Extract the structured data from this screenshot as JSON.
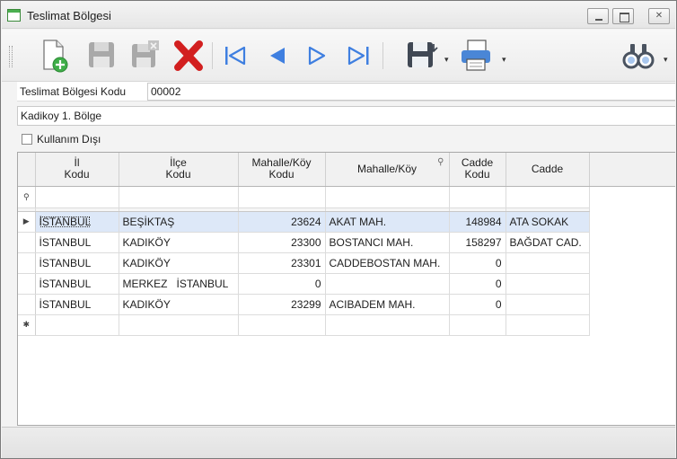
{
  "window": {
    "title": "Teslimat Bölgesi"
  },
  "toolbar": {
    "items": [
      "new-icon",
      "save-icon",
      "save-disabled-icon",
      "delete-icon",
      "first-record-icon",
      "previous-record-icon",
      "next-record-icon",
      "last-record-icon",
      "save-menu-icon",
      "print-icon",
      "search-icon"
    ]
  },
  "form": {
    "code_label": "Teslimat Bölgesi Kodu",
    "code_value": "00002",
    "name_value": "Kadikoy 1. Bölge",
    "inactive_label": "Kullanım Dışı",
    "inactive_checked": false
  },
  "grid": {
    "columns": [
      {
        "line1": "İl",
        "line2": "Kodu"
      },
      {
        "line1": "İlçe",
        "line2": "Kodu"
      },
      {
        "line1": "Mahalle/Köy",
        "line2": "Kodu"
      },
      {
        "line1": "Mahalle/Köy",
        "line2": ""
      },
      {
        "line1": "Cadde",
        "line2": "Kodu"
      },
      {
        "line1": "Cadde",
        "line2": ""
      }
    ],
    "rows": [
      {
        "il": "İSTANBUL",
        "ilce": "BEŞİKTAŞ",
        "mahalle_kodu": "23624",
        "mahalle": "AKAT MAH.",
        "cadde_kodu": "148984",
        "cadde": "ATA SOKAK"
      },
      {
        "il": "İSTANBUL",
        "ilce": "KADIKÖY",
        "mahalle_kodu": "23300",
        "mahalle": "BOSTANCI MAH.",
        "cadde_kodu": "158297",
        "cadde": "BAĞDAT CAD."
      },
      {
        "il": "İSTANBUL",
        "ilce": "KADIKÖY",
        "mahalle_kodu": "23301",
        "mahalle": "CADDEBOSTAN MAH.",
        "cadde_kodu": "0",
        "cadde": ""
      },
      {
        "il": "İSTANBUL",
        "ilce": "MERKEZ   İSTANBUL",
        "mahalle_kodu": "0",
        "mahalle": "",
        "cadde_kodu": "0",
        "cadde": ""
      },
      {
        "il": "İSTANBUL",
        "ilce": "KADIKÖY",
        "mahalle_kodu": "23299",
        "mahalle": "ACIBADEM MAH.",
        "cadde_kodu": "0",
        "cadde": ""
      }
    ],
    "selected_row": 0
  },
  "colors": {
    "selected_row": "#dde8f8",
    "delete": "#d21f1f",
    "nav": "#3f7fe0",
    "accent_green": "#4caf50"
  }
}
